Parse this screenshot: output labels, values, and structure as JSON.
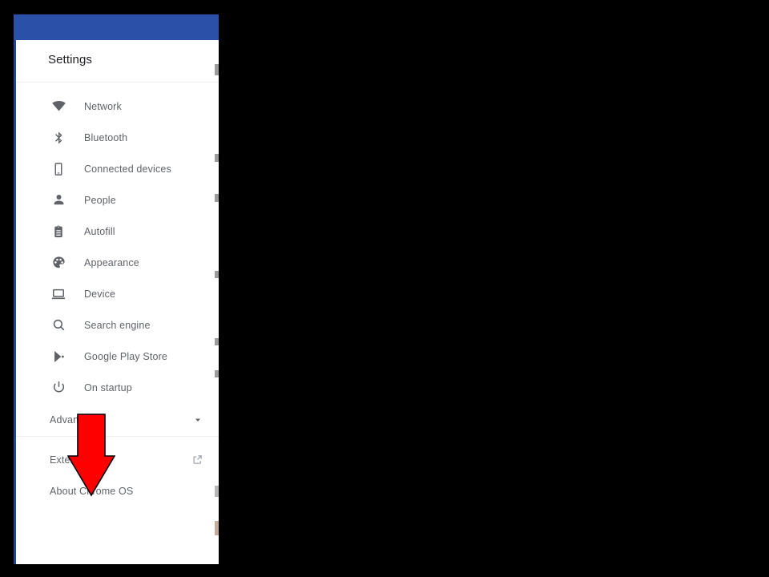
{
  "window": {
    "title_bar_color": "#2a50a8",
    "left_edge_color": "#21459c",
    "background": "#000000"
  },
  "settings": {
    "header": {
      "title": "Settings"
    },
    "nav_primary": [
      {
        "label": "Network",
        "icon": "wifi-icon"
      },
      {
        "label": "Bluetooth",
        "icon": "bluetooth-icon"
      },
      {
        "label": "Connected devices",
        "icon": "phone-icon"
      },
      {
        "label": "People",
        "icon": "person-icon"
      },
      {
        "label": "Autofill",
        "icon": "clipboard-icon"
      },
      {
        "label": "Appearance",
        "icon": "palette-icon"
      },
      {
        "label": "Device",
        "icon": "laptop-icon"
      },
      {
        "label": "Search engine",
        "icon": "magnifier-icon"
      },
      {
        "label": "Google Play Store",
        "icon": "google-play-icon"
      },
      {
        "label": "On startup",
        "icon": "power-icon"
      }
    ],
    "advanced": {
      "label": "Advanced",
      "expander_icon": "chevron-down-icon",
      "expanded": "false"
    },
    "footer": [
      {
        "label": "Extensions",
        "trailing_icon": "external-link-icon"
      },
      {
        "label": "About Chrome OS",
        "trailing_icon": ""
      }
    ]
  },
  "annotation": {
    "type": "arrow",
    "direction": "down",
    "color": "#fe0000",
    "outline_color": "#000000",
    "points_at": "About Chrome OS",
    "obscures": [
      "Advanced",
      "Extensions"
    ]
  }
}
